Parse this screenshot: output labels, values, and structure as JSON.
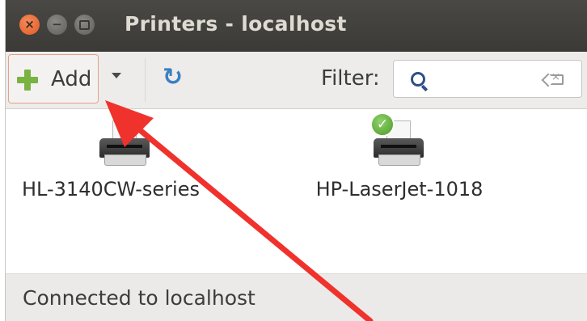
{
  "window": {
    "title": "Printers - localhost",
    "controls": [
      "close",
      "minimize",
      "maximize"
    ]
  },
  "toolbar": {
    "add_label": "Add",
    "filter_label": "Filter:",
    "search": {
      "value": "",
      "placeholder": ""
    }
  },
  "printers": [
    {
      "name": "HL-3140CW-series",
      "default": false
    },
    {
      "name": "HP-LaserJet-1018",
      "default": true
    }
  ],
  "status": {
    "text": "Connected to localhost"
  },
  "colors": {
    "titlebar": "#3c3b37",
    "close_button": "#e95420",
    "add_button_border": "#e6a086",
    "annotation_arrow": "#f0322c"
  }
}
